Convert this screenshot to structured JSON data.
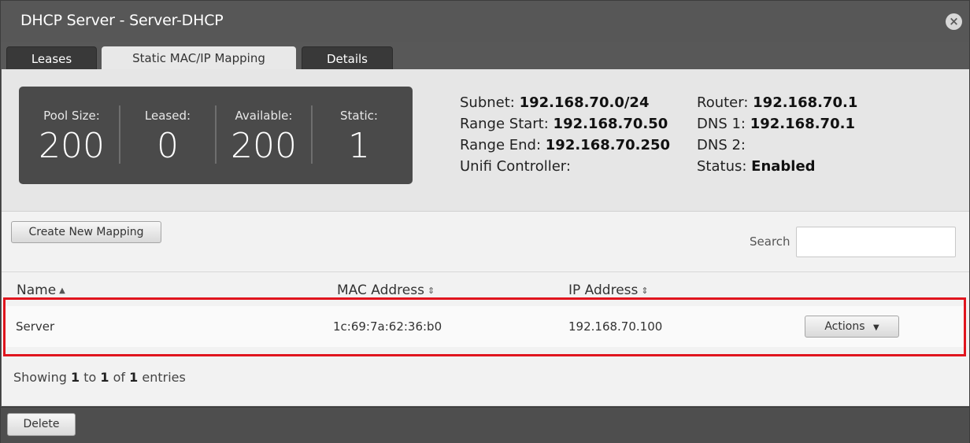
{
  "window": {
    "title": "DHCP Server - Server-DHCP",
    "close_symbol": "×"
  },
  "tabs": [
    {
      "label": "Leases",
      "active": false
    },
    {
      "label": "Static MAC/IP Mapping",
      "active": true
    },
    {
      "label": "Details",
      "active": false
    }
  ],
  "stats": [
    {
      "label": "Pool Size:",
      "value": "200"
    },
    {
      "label": "Leased:",
      "value": "0"
    },
    {
      "label": "Available:",
      "value": "200"
    },
    {
      "label": "Static:",
      "value": "1"
    }
  ],
  "info": {
    "subnet_label": "Subnet:",
    "subnet": "192.168.70.0/24",
    "range_start_label": "Range Start:",
    "range_start": "192.168.70.50",
    "range_end_label": "Range End:",
    "range_end": "192.168.70.250",
    "unifi_label": "Unifi Controller:",
    "unifi": "",
    "router_label": "Router:",
    "router": "192.168.70.1",
    "dns1_label": "DNS 1:",
    "dns1": "192.168.70.1",
    "dns2_label": "DNS 2:",
    "dns2": "",
    "status_label": "Status:",
    "status": "Enabled"
  },
  "toolbar": {
    "create_label": "Create New Mapping",
    "search_label": "Search",
    "search_value": ""
  },
  "table": {
    "columns": [
      "Name",
      "MAC Address",
      "IP Address"
    ],
    "rows": [
      {
        "name": "Server",
        "mac": "1c:69:7a:62:36:b0",
        "ip": "192.168.70.100",
        "actions_label": "Actions"
      }
    ]
  },
  "footer": {
    "showing": "Showing",
    "from": "1",
    "to_word": "to",
    "to": "1",
    "of_word": "of",
    "total": "1",
    "entries": "entries"
  },
  "bottom": {
    "delete_label": "Delete"
  },
  "colors": {
    "highlight": "#e0151e",
    "stats_bg": "#4a4a4a"
  }
}
